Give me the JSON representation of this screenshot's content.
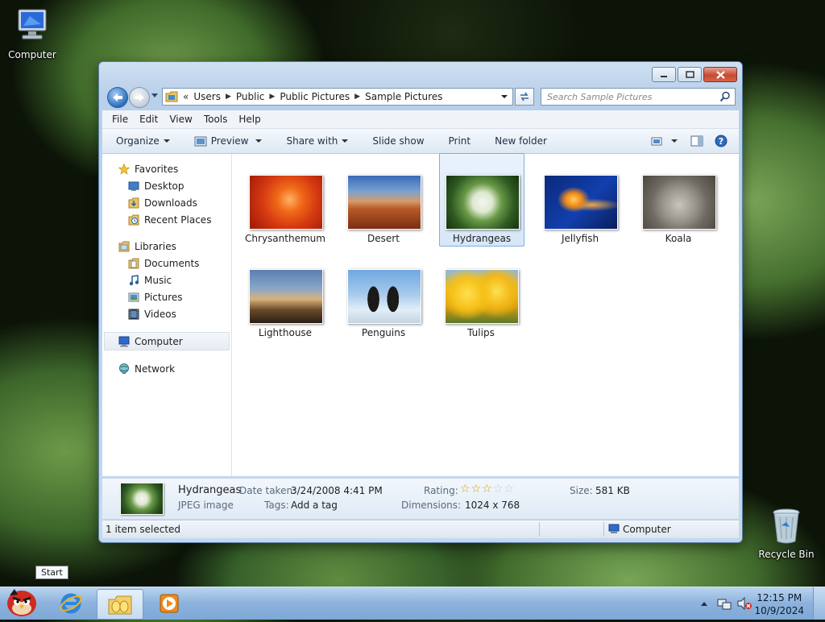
{
  "desktop": {
    "computer_label": "Computer",
    "recycle_label": "Recycle Bin"
  },
  "window": {
    "breadcrumb": [
      "Users",
      "Public",
      "Public Pictures",
      "Sample Pictures"
    ],
    "breadcrumb_prefix": "«",
    "search_placeholder": "Search Sample Pictures",
    "menu": [
      "File",
      "Edit",
      "View",
      "Tools",
      "Help"
    ],
    "commands": {
      "organize": "Organize",
      "preview": "Preview",
      "share": "Share with",
      "slideshow": "Slide show",
      "print": "Print",
      "newfolder": "New folder"
    },
    "nav": {
      "favorites": "Favorites",
      "desktop": "Desktop",
      "downloads": "Downloads",
      "recent": "Recent Places",
      "libraries": "Libraries",
      "documents": "Documents",
      "music": "Music",
      "pictures": "Pictures",
      "videos": "Videos",
      "computer": "Computer",
      "network": "Network"
    },
    "files": [
      {
        "name": "Chrysanthemum"
      },
      {
        "name": "Desert"
      },
      {
        "name": "Hydrangeas"
      },
      {
        "name": "Jellyfish"
      },
      {
        "name": "Koala"
      },
      {
        "name": "Lighthouse"
      },
      {
        "name": "Penguins"
      },
      {
        "name": "Tulips"
      }
    ],
    "selected_file": "Hydrangeas",
    "details": {
      "name": "Hydrangeas",
      "type": "JPEG image",
      "date_label": "Date taken:",
      "date_value": "3/24/2008 4:41 PM",
      "tags_label": "Tags:",
      "tags_value": "Add a tag",
      "rating_label": "Rating:",
      "rating": 3,
      "rating_max": 5,
      "dimensions_label": "Dimensions:",
      "dimensions_value": "1024 x 768",
      "size_label": "Size:",
      "size_value": "581 KB"
    },
    "status": {
      "selection": "1 item selected",
      "location": "Computer"
    }
  },
  "taskbar": {
    "start_tooltip": "Start",
    "time": "12:15 PM",
    "date": "10/9/2024"
  }
}
